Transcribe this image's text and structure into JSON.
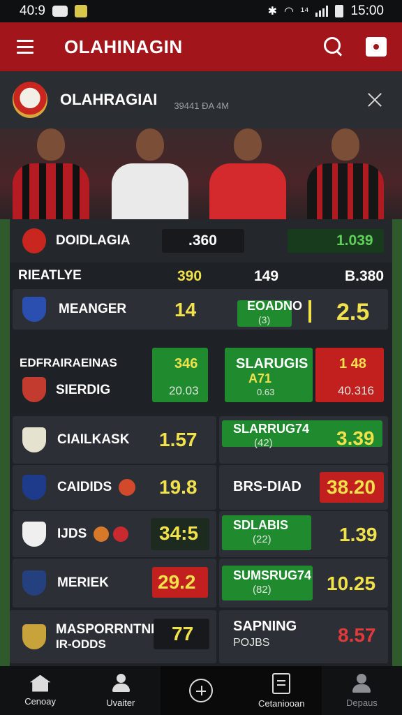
{
  "status": {
    "left_text": "40:9",
    "time": "15:00",
    "signal_text": "¹⁴"
  },
  "app": {
    "title": "OLAHINAGIN"
  },
  "league": {
    "title": "OLAHRAGIAI",
    "subtitle": "39441 ÐA 4M"
  },
  "section1": {
    "team": "DOIDLAGIA",
    "chip1_value": ".360",
    "chip2_value": "1.039",
    "row_label": "RIEATLYE",
    "c1": "390",
    "c2": "149",
    "c3": "B.380"
  },
  "row_meanger": {
    "team": "MEANGER",
    "odd": "14",
    "mid_label": "EOADNO",
    "mid_sub": "(3)",
    "right_odd": "2.5"
  },
  "block_siergig": {
    "header": "EDFRAIRAEINAS",
    "team": "SIERDIG",
    "g1_top": "346",
    "g1_bot": "20.03",
    "mid_label": "SLARUGIS",
    "mid_sub1": "A71",
    "mid_sub2": "0.63",
    "red_top": "1 48",
    "red_bot": "40.316"
  },
  "rows": [
    {
      "team": "CIAILKASK",
      "odd": "1.57",
      "right_label": "SLARRUG74",
      "right_sub": "(42)",
      "right_odd": "3.39"
    },
    {
      "team": "CAIDIDS",
      "odd": "19.8",
      "right_label": "BRS-DIAD",
      "right_sub": "",
      "right_odd": "38.20"
    },
    {
      "team": "IJDS",
      "odd": "34:5",
      "right_label": "SDLABIS",
      "right_sub": "(22)",
      "right_odd": "1.39"
    },
    {
      "team": "MERIEK",
      "odd": "29.2",
      "right_label": "SUMSRUG74",
      "right_sub": "(82)",
      "right_odd": "10.25"
    },
    {
      "team": "MASPORRNTNE",
      "team2": "IR-ODDS",
      "odd": "77",
      "right_label": "SAPNING",
      "right_sub": "POJBS",
      "right_odd": "8.57"
    }
  ],
  "nav": {
    "items": [
      {
        "label": "Cenoay"
      },
      {
        "label": "Uvaiter"
      },
      {
        "label": ""
      },
      {
        "label": "Cetaniooan"
      },
      {
        "label": "Depaus"
      }
    ]
  },
  "colors": {
    "brand_red": "#a2161b",
    "odds_green": "#1f8a2e",
    "odds_yellow": "#f1e24c"
  }
}
